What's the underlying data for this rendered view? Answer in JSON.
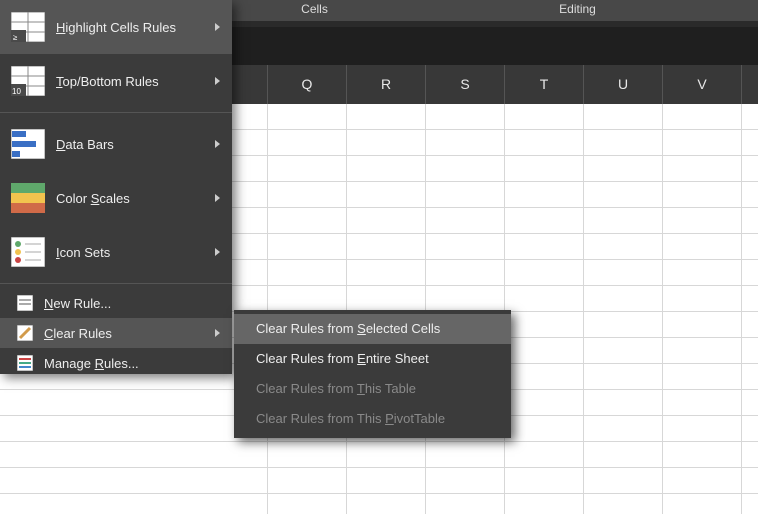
{
  "ribbon": {
    "group_cells": "Cells",
    "group_editing": "Editing"
  },
  "columns": [
    "Q",
    "R",
    "S",
    "T",
    "U",
    "V"
  ],
  "menu": {
    "highlight": {
      "label_pre": "H",
      "label_post": "ighlight Cells Rules"
    },
    "topbottom": {
      "label_pre": "T",
      "label_post": "op/Bottom Rules"
    },
    "databars": {
      "label_pre": "D",
      "label_post": "ata Bars"
    },
    "colorscales": {
      "label_pre": "Color ",
      "label_mid": "S",
      "label_post": "cales"
    },
    "iconsets": {
      "label_pre": "I",
      "label_post": "con Sets"
    },
    "newrule": {
      "label_pre": "N",
      "label_post": "ew Rule..."
    },
    "clearrules": {
      "label_pre": "C",
      "label_post": "lear Rules"
    },
    "manage": {
      "label_pre": "Manage ",
      "label_mid": "R",
      "label_post": "ules..."
    }
  },
  "submenu": {
    "selected": {
      "pre": "Clear Rules from ",
      "mid": "S",
      "post": "elected Cells"
    },
    "entire": {
      "pre": "Clear Rules from ",
      "mid": "E",
      "post": "ntire Sheet"
    },
    "table": {
      "pre": "Clear Rules from ",
      "mid": "T",
      "post": "his Table"
    },
    "pivot": {
      "pre": "Clear Rules from This ",
      "mid": "P",
      "post": "ivotTable"
    }
  }
}
